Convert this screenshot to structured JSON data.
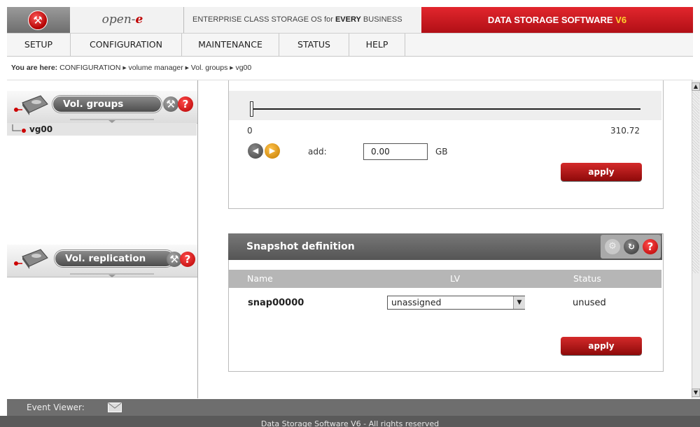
{
  "header": {
    "brand": "open-e",
    "tagline_prefix": "ENTERPRISE CLASS STORAGE OS for ",
    "tagline_bold": "EVERY",
    "tagline_suffix": " BUSINESS",
    "product_main": "DATA STORAGE SOFTWARE ",
    "product_version": "V6",
    "accent_color": "#c8141c"
  },
  "menu": {
    "items": [
      {
        "label": "SETUP"
      },
      {
        "label": "CONFIGURATION"
      },
      {
        "label": "MAINTENANCE"
      },
      {
        "label": "STATUS"
      },
      {
        "label": "HELP"
      }
    ]
  },
  "breadcrumb": {
    "prefix": "You are here:",
    "path": "CONFIGURATION ▸ volume manager ▸ Vol. groups ▸ vg00"
  },
  "sidebar": {
    "volgroups_title": "Vol. groups",
    "tree_item": "vg00",
    "replication_title": "Vol. replication"
  },
  "resize": {
    "slider_min": "0",
    "slider_max": "310.72",
    "slider_fraction": 0.0,
    "add_label": "add:",
    "add_value": "0.00",
    "unit": "GB",
    "apply_label": "apply"
  },
  "snapshot": {
    "title": "Snapshot definition",
    "col_name": "Name",
    "col_lv": "LV",
    "col_status": "Status",
    "row_name": "snap00000",
    "row_lv": "unassigned",
    "row_status": "unused",
    "apply_label": "apply"
  },
  "footer": {
    "event_viewer": "Event Viewer:",
    "copyright": "Data Storage Software V6 - All rights reserved"
  }
}
